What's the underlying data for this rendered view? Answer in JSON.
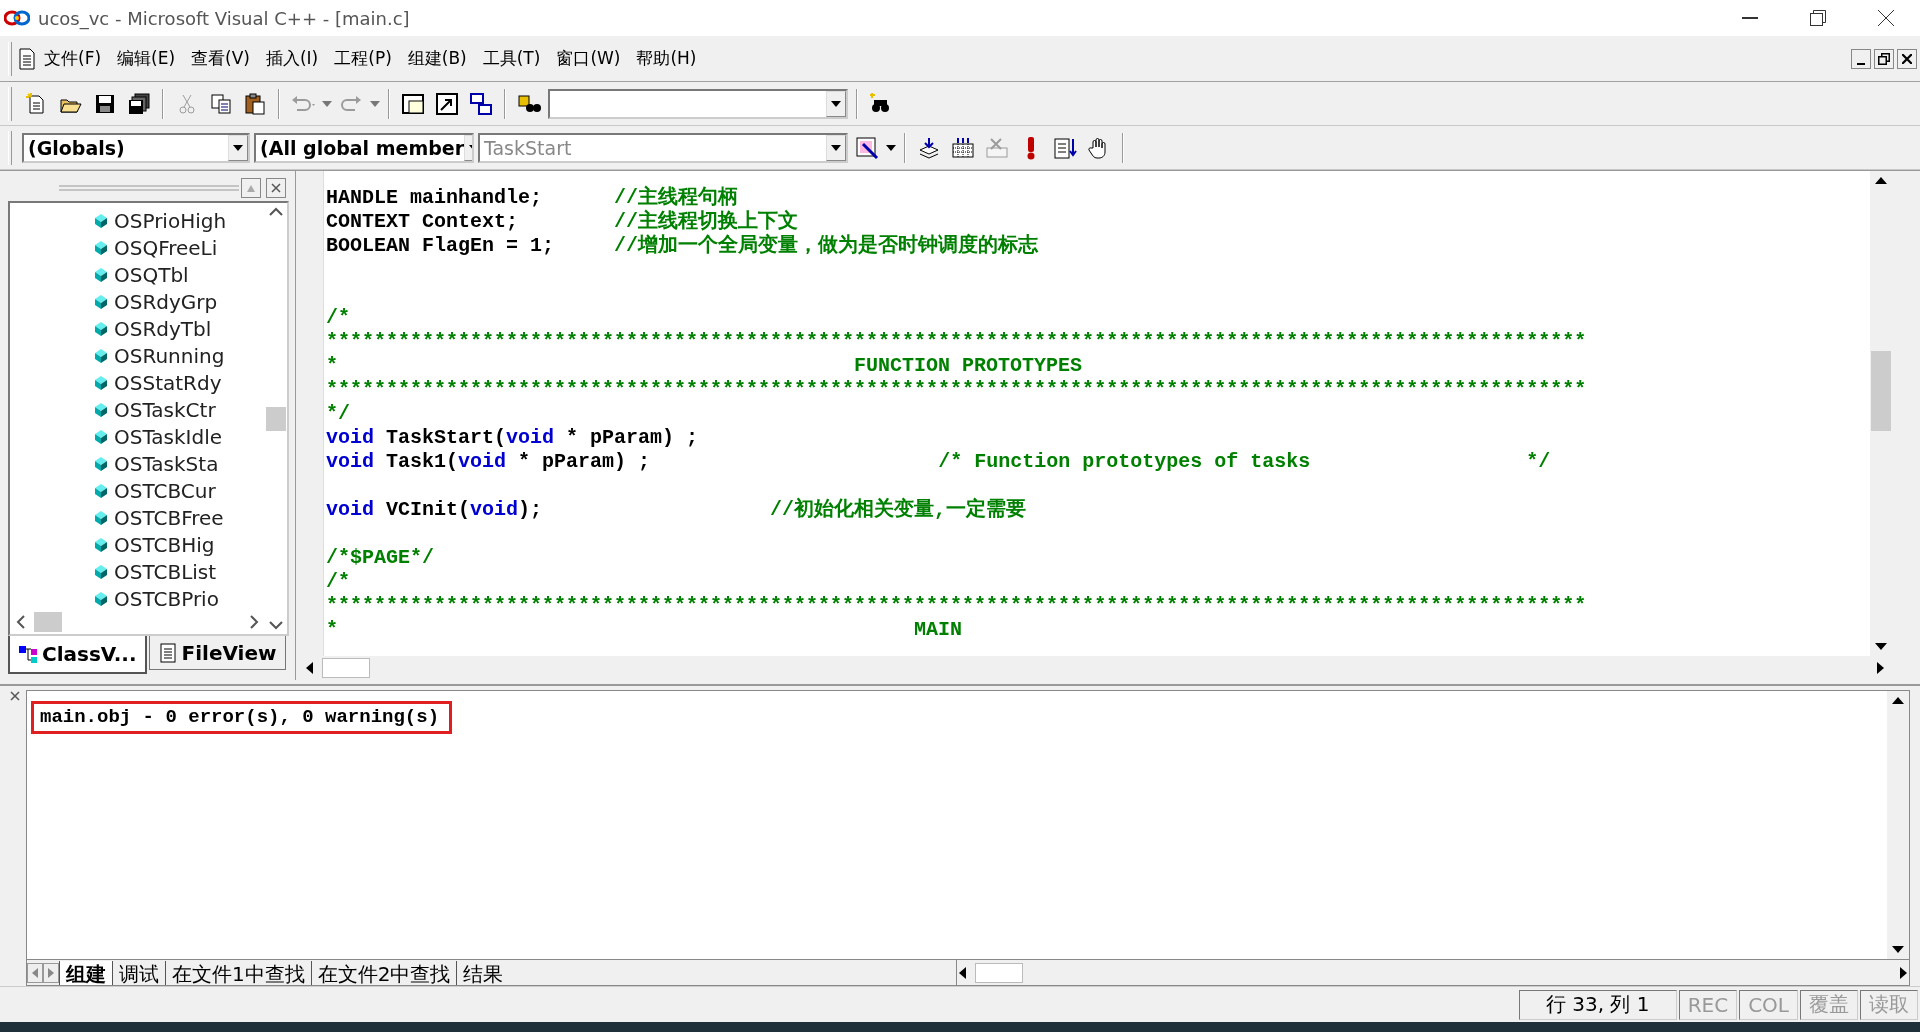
{
  "window": {
    "title": "ucos_vc - Microsoft Visual C++ - [main.c]"
  },
  "menu": [
    "文件(F)",
    "编辑(E)",
    "查看(V)",
    "插入(I)",
    "工程(P)",
    "组建(B)",
    "工具(T)",
    "窗口(W)",
    "帮助(H)"
  ],
  "toolbar_standard": [
    {
      "disabled": false
    },
    {
      "disabled": false
    },
    {
      "disabled": false
    },
    {
      "disabled": false
    },
    {
      "disabled": true
    },
    {
      "disabled": false
    },
    {
      "disabled": false
    },
    {
      "disabled": true
    },
    {
      "disabled": true
    },
    {
      "disabled": false
    },
    {
      "disabled": false
    },
    {
      "disabled": false
    },
    {
      "disabled": false
    },
    {
      "disabled": false
    }
  ],
  "wizard_bar": {
    "class_combo": "(Globals)",
    "filter_combo": "(All global member",
    "member_combo": "TaskStart",
    "member_disabled": true
  },
  "toolbar_build": [
    {
      "disabled": false
    },
    {
      "disabled": false
    },
    {
      "disabled": true
    },
    {
      "disabled": false
    },
    {
      "disabled": false
    },
    {
      "disabled": false
    }
  ],
  "workspace": {
    "tree_items": [
      "OSPrioHigh",
      "OSQFreeLi",
      "OSQTbl",
      "OSRdyGrp",
      "OSRdyTbl",
      "OSRunning",
      "OSStatRdy",
      "OSTaskCtr",
      "OSTaskIdle",
      "OSTaskSta",
      "OSTCBCur",
      "OSTCBFree",
      "OSTCBHig",
      "OSTCBList",
      "OSTCBPrio"
    ],
    "tabs": [
      {
        "label": "ClassV...",
        "selected": true
      },
      {
        "label": "FileView",
        "selected": false
      }
    ]
  },
  "editor": {
    "lines": [
      {
        "kind": "code",
        "segments": [
          {
            "kind": "plain",
            "text": "HANDLE mainhandle;      "
          },
          {
            "kind": "comment",
            "text": "//主线程句柄"
          }
        ]
      },
      {
        "kind": "code",
        "segments": [
          {
            "kind": "plain",
            "text": "CONTEXT Context;        "
          },
          {
            "kind": "comment",
            "text": "//主线程切换上下文"
          }
        ]
      },
      {
        "kind": "code",
        "segments": [
          {
            "kind": "plain",
            "text": "BOOLEAN FlagEn = 1;     "
          },
          {
            "kind": "comment",
            "text": "//增加一个全局变量，做为是否时钟调度的标志"
          }
        ]
      },
      {
        "kind": "blank"
      },
      {
        "kind": "blank"
      },
      {
        "kind": "code",
        "segments": [
          {
            "kind": "comment",
            "text": "/*"
          }
        ]
      },
      {
        "kind": "code",
        "segments": [
          {
            "kind": "comment",
            "text": "*********************************************************************************************************"
          }
        ]
      },
      {
        "kind": "code",
        "segments": [
          {
            "kind": "comment",
            "text": "*                                           FUNCTION PROTOTYPES"
          }
        ]
      },
      {
        "kind": "code",
        "segments": [
          {
            "kind": "comment",
            "text": "*********************************************************************************************************"
          }
        ]
      },
      {
        "kind": "code",
        "segments": [
          {
            "kind": "comment",
            "text": "*/"
          }
        ]
      },
      {
        "kind": "code",
        "segments": [
          {
            "kind": "keyword",
            "text": "void"
          },
          {
            "kind": "plain",
            "text": " TaskStart("
          },
          {
            "kind": "keyword",
            "text": "void"
          },
          {
            "kind": "plain",
            "text": " * pParam) ;"
          }
        ]
      },
      {
        "kind": "code",
        "segments": [
          {
            "kind": "keyword",
            "text": "void"
          },
          {
            "kind": "plain",
            "text": " Task1("
          },
          {
            "kind": "keyword",
            "text": "void"
          },
          {
            "kind": "plain",
            "text": " * pParam) ;                        "
          },
          {
            "kind": "comment",
            "text": "/* Function prototypes of tasks                  */"
          }
        ]
      },
      {
        "kind": "blank"
      },
      {
        "kind": "code",
        "segments": [
          {
            "kind": "keyword",
            "text": "void"
          },
          {
            "kind": "plain",
            "text": " VCInit("
          },
          {
            "kind": "keyword",
            "text": "void"
          },
          {
            "kind": "plain",
            "text": ");                   "
          },
          {
            "kind": "comment",
            "text": "//初始化相关变量,一定需要"
          }
        ]
      },
      {
        "kind": "blank"
      },
      {
        "kind": "code",
        "segments": [
          {
            "kind": "comment",
            "text": "/*$PAGE*/"
          }
        ]
      },
      {
        "kind": "code",
        "segments": [
          {
            "kind": "comment",
            "text": "/*"
          }
        ]
      },
      {
        "kind": "code",
        "segments": [
          {
            "kind": "comment",
            "text": "*********************************************************************************************************"
          }
        ]
      },
      {
        "kind": "code",
        "segments": [
          {
            "kind": "comment",
            "text": "*                                                MAIN"
          }
        ]
      }
    ]
  },
  "output": {
    "messages": [
      {
        "text": "main.obj - 0 error(s), 0 warning(s)",
        "highlighted": true
      }
    ],
    "tabs": [
      {
        "label": "组建",
        "selected": true
      },
      {
        "label": "调试",
        "selected": false
      },
      {
        "label": "在文件1中查找",
        "selected": false
      },
      {
        "label": "在文件2中查找",
        "selected": false
      },
      {
        "label": "结果",
        "selected": false
      }
    ]
  },
  "status_bar": {
    "position": "行 33, 列 1",
    "indicators": [
      {
        "label": "REC",
        "disabled": true
      },
      {
        "label": "COL",
        "disabled": true
      },
      {
        "label": "覆盖",
        "disabled": true
      },
      {
        "label": "读取",
        "disabled": true
      }
    ]
  }
}
